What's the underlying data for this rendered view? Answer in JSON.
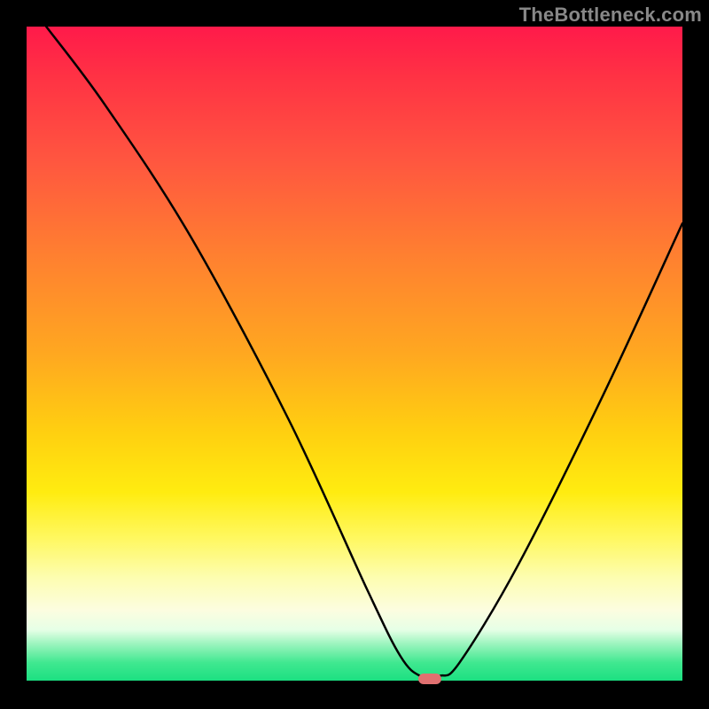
{
  "watermark": "TheBottleneck.com",
  "chart_data": {
    "type": "line",
    "title": "",
    "xlabel": "",
    "ylabel": "",
    "xlim": [
      0,
      100
    ],
    "ylim": [
      0,
      100
    ],
    "grid": false,
    "legend": false,
    "background": "gradient-red-to-green-vertical",
    "series": [
      {
        "name": "bottleneck-curve",
        "color": "#000000",
        "x": [
          3,
          12,
          25,
          40,
          52,
          57,
          60,
          63,
          66,
          75,
          88,
          100
        ],
        "values": [
          100,
          88,
          68,
          40,
          14,
          4,
          1,
          1,
          3,
          18,
          44,
          70
        ]
      }
    ],
    "marker": {
      "x": 61.5,
      "y": 0.5,
      "color": "#e07070",
      "shape": "pill"
    }
  }
}
